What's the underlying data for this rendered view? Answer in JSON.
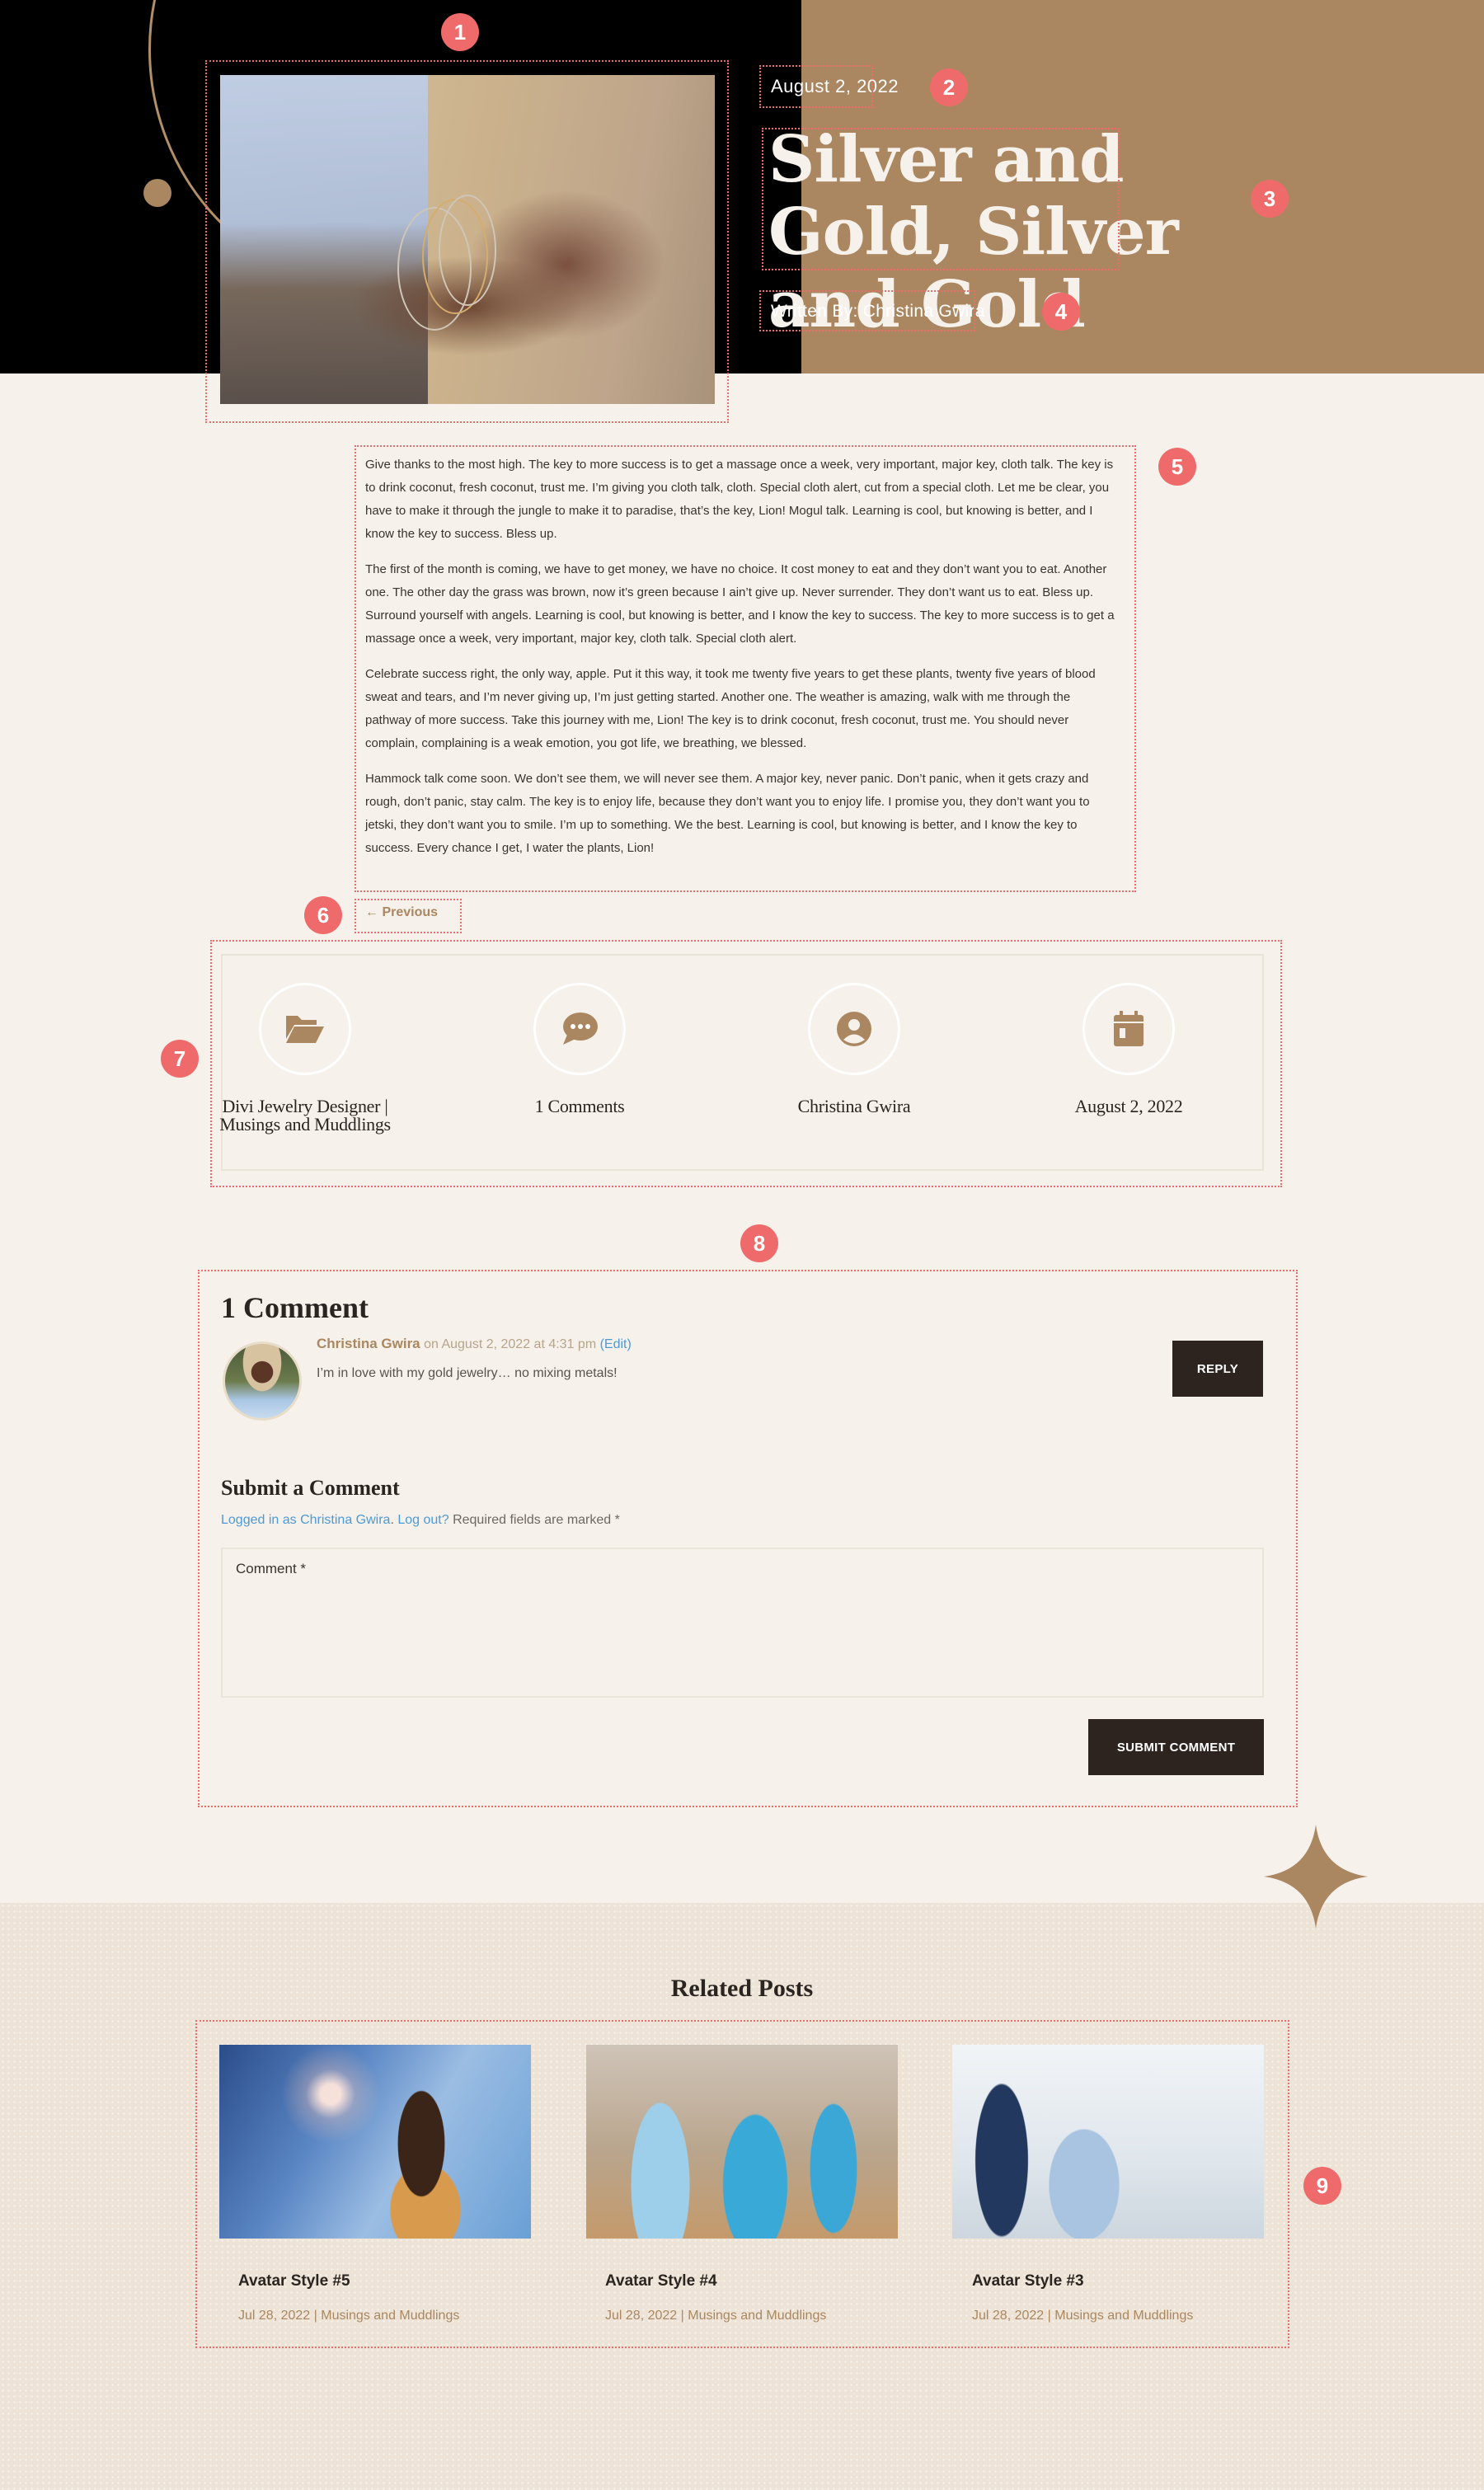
{
  "hero": {
    "date": "August 2, 2022",
    "title": "Silver and Gold, Silver and Gold",
    "byline": "Written By: Christina Gwira",
    "image_alt": "Wrist wearing silver and gold bangle bracelets"
  },
  "post": {
    "paragraphs": [
      "Give thanks to the most high. The key to more success is to get a massage once a week, very important, major key, cloth talk. The key is to drink coconut, fresh coconut, trust me. I’m giving you cloth talk, cloth. Special cloth alert, cut from a special cloth. Let me be clear, you have to make it through the jungle to make it to paradise, that’s the key, Lion! Mogul talk. Learning is cool, but knowing is better, and I know the key to success. Bless up.",
      "The first of the month is coming, we have to get money, we have no choice. It cost money to eat and they don’t want you to eat. Another one. The other day the grass was brown, now it’s green because I ain’t give up. Never surrender. They don’t want us to eat. Bless up. Surround yourself with angels. Learning is cool, but knowing is better, and I know the key to success. The key to more success is to get a massage once a week, very important, major key, cloth talk. Special cloth alert.",
      "Celebrate success right, the only way, apple. Put it this way, it took me twenty five years to get these plants, twenty five years of blood sweat and tears, and I’m never giving up, I’m just getting started. Another one. The weather is amazing, walk with me through the pathway of more success. Take this journey with me, Lion! The key is to drink coconut, fresh coconut, trust me. You should never complain, complaining is a weak emotion, you got life, we breathing, we blessed.",
      "Hammock talk come soon. We don’t see them, we will never see them. A major key, never panic. Don’t panic, when it gets crazy and rough, don’t panic, stay calm. The key is to enjoy life, because they don’t want you to enjoy life. I promise you, they don’t want you to jetski, they don’t want you to smile. I’m up to something. We the best. Learning is cool, but knowing is better, and I know the key to success. Every chance I get, I water the plants, Lion!"
    ],
    "previous_link": "← Previous"
  },
  "meta": {
    "items": [
      {
        "icon": "folder-open-icon",
        "label_line1": "Divi Jewelry Designer |",
        "label_line2": "Musings and Muddlings"
      },
      {
        "icon": "comment-dots-icon",
        "label_line1": "1 Comments",
        "label_line2": ""
      },
      {
        "icon": "user-circle-icon",
        "label_line1": "Christina Gwira",
        "label_line2": ""
      },
      {
        "icon": "calendar-icon",
        "label_line1": "August 2, 2022",
        "label_line2": ""
      }
    ]
  },
  "comments": {
    "title": "1 Comment",
    "list": [
      {
        "author": "Christina Gwira",
        "date": "on August 2, 2022 at 4:31 pm",
        "edit_label": "(Edit)",
        "text": "I’m in love with my gold jewelry… no mixing metals!",
        "reply_label": "REPLY"
      }
    ],
    "form": {
      "title": "Submit a Comment",
      "logged_in_link": "Logged in as Christina Gwira",
      "separator": ".",
      "logout_link": "Log out?",
      "required_note": "Required fields are marked *",
      "comment_placeholder": "Comment *",
      "comment_value": "",
      "submit_label": "SUBMIT COMMENT"
    }
  },
  "related": {
    "title": "Related Posts",
    "posts": [
      {
        "name": "Avatar Style #5",
        "date": "Jul 28, 2022",
        "separator": "|",
        "category": "Musings and Muddlings"
      },
      {
        "name": "Avatar Style #4",
        "date": "Jul 28, 2022",
        "separator": "|",
        "category": "Musings and Muddlings"
      },
      {
        "name": "Avatar Style #3",
        "date": "Jul 28, 2022",
        "separator": "|",
        "category": "Musings and Muddlings"
      }
    ]
  },
  "annotations": [
    "1",
    "2",
    "3",
    "4",
    "5",
    "6",
    "7",
    "8",
    "9"
  ],
  "colors": {
    "accent_gold": "#aa8760",
    "hero_black": "#000000",
    "page_bg": "#f6f1eb",
    "related_bg": "#ede4d7",
    "button_dark": "#2d2420",
    "link_blue": "#4c9ad8",
    "annotation_red": "#ef6b6b"
  }
}
